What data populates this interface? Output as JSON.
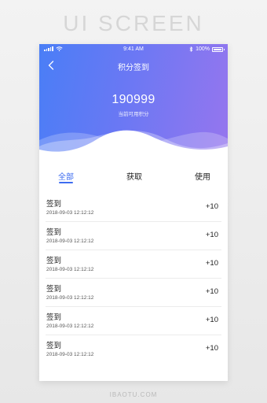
{
  "showcase": {
    "title": "UI SCREEN",
    "watermark": "IBAOTU.COM"
  },
  "status_bar": {
    "time": "9:41 AM",
    "battery": "100%"
  },
  "nav": {
    "back_icon": "chevron-left-icon",
    "title": "积分签到"
  },
  "points": {
    "value": "190999",
    "caption": "当前可用积分"
  },
  "tabs": [
    {
      "label": "全部",
      "active": true
    },
    {
      "label": "获取",
      "active": false
    },
    {
      "label": "使用",
      "active": false
    }
  ],
  "records": [
    {
      "title": "签到",
      "time": "2018-09-03 12:12:12",
      "delta": "+10"
    },
    {
      "title": "签到",
      "time": "2018-09-03 12:12:12",
      "delta": "+10"
    },
    {
      "title": "签到",
      "time": "2018-09-03 12:12:12",
      "delta": "+10"
    },
    {
      "title": "签到",
      "time": "2018-09-03 12:12:12",
      "delta": "+10"
    },
    {
      "title": "签到",
      "time": "2018-09-03 12:12:12",
      "delta": "+10"
    },
    {
      "title": "签到",
      "time": "2018-09-03 12:12:12",
      "delta": "+10"
    }
  ],
  "colors": {
    "accent": "#3d6cf0",
    "gradient_start": "#4a7ef6",
    "gradient_end": "#9676ee"
  }
}
